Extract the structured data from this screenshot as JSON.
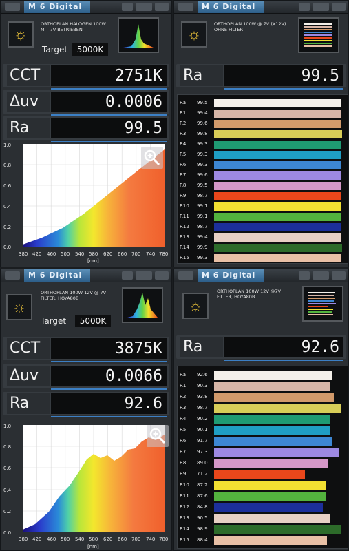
{
  "panels": [
    {
      "app_title": "M 6 Digital",
      "subtitle": [
        "ORTHOPLAN HALOGEN 100W",
        "MIT 7V BETRIEBEN"
      ],
      "target_label": "Target",
      "target_value": "5000K",
      "measurements": [
        {
          "label": "CCT",
          "value": "2751K"
        },
        {
          "label": "Δuv",
          "value": "0.0006"
        },
        {
          "label": "Ra",
          "value": "99.5"
        }
      ],
      "spectrum": {
        "ylabels": [
          "1.0",
          "0.8",
          "0.6",
          "0.4",
          "0.2",
          "0.0"
        ],
        "xlabels": [
          "380",
          "420",
          "460",
          "500",
          "540",
          "580",
          "620",
          "660",
          "700",
          "740",
          "780"
        ],
        "unit": "[nm]"
      }
    },
    {
      "app_title": "M 6 Digital",
      "subtitle": [
        "ORTHOPLAN 100W @ 7V (X12V)",
        "OHNE FILTER"
      ],
      "ra_label": "Ra",
      "ra_value": "99.5",
      "rows": [
        {
          "name": "Ra",
          "value": "99.5"
        },
        {
          "name": "R1",
          "value": "99.4"
        },
        {
          "name": "R2",
          "value": "99.6"
        },
        {
          "name": "R3",
          "value": "99.8"
        },
        {
          "name": "R4",
          "value": "99.3"
        },
        {
          "name": "R5",
          "value": "99.3"
        },
        {
          "name": "R6",
          "value": "99.3"
        },
        {
          "name": "R7",
          "value": "99.6"
        },
        {
          "name": "R8",
          "value": "99.5"
        },
        {
          "name": "R9",
          "value": "98.7"
        },
        {
          "name": "R10",
          "value": "99.1"
        },
        {
          "name": "R11",
          "value": "99.1"
        },
        {
          "name": "R12",
          "value": "98.7"
        },
        {
          "name": "R13",
          "value": "99.4"
        },
        {
          "name": "R14",
          "value": "99.9"
        },
        {
          "name": "R15",
          "value": "99.3"
        }
      ]
    },
    {
      "app_title": "M 6 Digital",
      "subtitle": [
        "ORTHOPLAN 100W 12V @ 7V",
        "FILTER, HOYA80B"
      ],
      "target_label": "Target",
      "target_value": "5000K",
      "measurements": [
        {
          "label": "CCT",
          "value": "3875K"
        },
        {
          "label": "Δuv",
          "value": "0.0066"
        },
        {
          "label": "Ra",
          "value": "92.6"
        }
      ],
      "spectrum": {
        "ylabels": [
          "1.0",
          "0.8",
          "0.6",
          "0.4",
          "0.2",
          "0.0"
        ],
        "xlabels": [
          "380",
          "420",
          "460",
          "500",
          "540",
          "580",
          "620",
          "660",
          "700",
          "740",
          "780"
        ],
        "unit": "[nm]"
      }
    },
    {
      "app_title": "M 6 Digital",
      "subtitle": [
        "ORTHOPLAN 100W 12V @7V",
        "FILTER, HOYA80B"
      ],
      "ra_label": "Ra",
      "ra_value": "92.6",
      "rows": [
        {
          "name": "Ra",
          "value": "92.6"
        },
        {
          "name": "R1",
          "value": "90.3"
        },
        {
          "name": "R2",
          "value": "93.8"
        },
        {
          "name": "R3",
          "value": "98.7"
        },
        {
          "name": "R4",
          "value": "90.2"
        },
        {
          "name": "R5",
          "value": "90.1"
        },
        {
          "name": "R6",
          "value": "91.7"
        },
        {
          "name": "R7",
          "value": "97.3"
        },
        {
          "name": "R8",
          "value": "89.0"
        },
        {
          "name": "R9",
          "value": "71.2"
        },
        {
          "name": "R10",
          "value": "87.2"
        },
        {
          "name": "R11",
          "value": "87.6"
        },
        {
          "name": "R12",
          "value": "84.8"
        },
        {
          "name": "R13",
          "value": "90.5"
        },
        {
          "name": "R14",
          "value": "98.9"
        },
        {
          "name": "R15",
          "value": "88.4"
        }
      ]
    }
  ],
  "bar_colors": [
    "#f4f0ea",
    "#d7b6a8",
    "#d29a6b",
    "#d8cd58",
    "#1f9a73",
    "#1f9ec4",
    "#3d87d3",
    "#9d89e2",
    "#d598c8",
    "#e9471b",
    "#f2e032",
    "#53b33e",
    "#1c2f9a",
    "#e8d0c4",
    "#2d6b2a",
    "#e8c0a6"
  ]
}
